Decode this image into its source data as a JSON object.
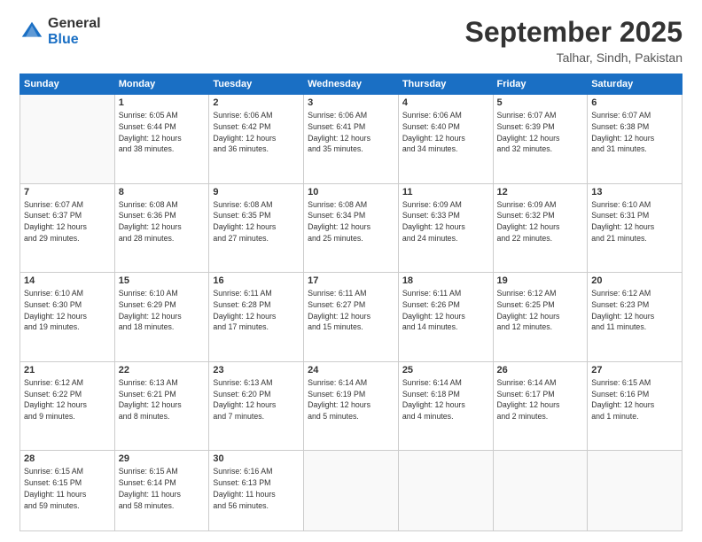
{
  "logo": {
    "general": "General",
    "blue": "Blue"
  },
  "title": {
    "month_year": "September 2025",
    "location": "Talhar, Sindh, Pakistan"
  },
  "days_header": [
    "Sunday",
    "Monday",
    "Tuesday",
    "Wednesday",
    "Thursday",
    "Friday",
    "Saturday"
  ],
  "weeks": [
    [
      {
        "num": "",
        "info": ""
      },
      {
        "num": "1",
        "info": "Sunrise: 6:05 AM\nSunset: 6:44 PM\nDaylight: 12 hours\nand 38 minutes."
      },
      {
        "num": "2",
        "info": "Sunrise: 6:06 AM\nSunset: 6:42 PM\nDaylight: 12 hours\nand 36 minutes."
      },
      {
        "num": "3",
        "info": "Sunrise: 6:06 AM\nSunset: 6:41 PM\nDaylight: 12 hours\nand 35 minutes."
      },
      {
        "num": "4",
        "info": "Sunrise: 6:06 AM\nSunset: 6:40 PM\nDaylight: 12 hours\nand 34 minutes."
      },
      {
        "num": "5",
        "info": "Sunrise: 6:07 AM\nSunset: 6:39 PM\nDaylight: 12 hours\nand 32 minutes."
      },
      {
        "num": "6",
        "info": "Sunrise: 6:07 AM\nSunset: 6:38 PM\nDaylight: 12 hours\nand 31 minutes."
      }
    ],
    [
      {
        "num": "7",
        "info": "Sunrise: 6:07 AM\nSunset: 6:37 PM\nDaylight: 12 hours\nand 29 minutes."
      },
      {
        "num": "8",
        "info": "Sunrise: 6:08 AM\nSunset: 6:36 PM\nDaylight: 12 hours\nand 28 minutes."
      },
      {
        "num": "9",
        "info": "Sunrise: 6:08 AM\nSunset: 6:35 PM\nDaylight: 12 hours\nand 27 minutes."
      },
      {
        "num": "10",
        "info": "Sunrise: 6:08 AM\nSunset: 6:34 PM\nDaylight: 12 hours\nand 25 minutes."
      },
      {
        "num": "11",
        "info": "Sunrise: 6:09 AM\nSunset: 6:33 PM\nDaylight: 12 hours\nand 24 minutes."
      },
      {
        "num": "12",
        "info": "Sunrise: 6:09 AM\nSunset: 6:32 PM\nDaylight: 12 hours\nand 22 minutes."
      },
      {
        "num": "13",
        "info": "Sunrise: 6:10 AM\nSunset: 6:31 PM\nDaylight: 12 hours\nand 21 minutes."
      }
    ],
    [
      {
        "num": "14",
        "info": "Sunrise: 6:10 AM\nSunset: 6:30 PM\nDaylight: 12 hours\nand 19 minutes."
      },
      {
        "num": "15",
        "info": "Sunrise: 6:10 AM\nSunset: 6:29 PM\nDaylight: 12 hours\nand 18 minutes."
      },
      {
        "num": "16",
        "info": "Sunrise: 6:11 AM\nSunset: 6:28 PM\nDaylight: 12 hours\nand 17 minutes."
      },
      {
        "num": "17",
        "info": "Sunrise: 6:11 AM\nSunset: 6:27 PM\nDaylight: 12 hours\nand 15 minutes."
      },
      {
        "num": "18",
        "info": "Sunrise: 6:11 AM\nSunset: 6:26 PM\nDaylight: 12 hours\nand 14 minutes."
      },
      {
        "num": "19",
        "info": "Sunrise: 6:12 AM\nSunset: 6:25 PM\nDaylight: 12 hours\nand 12 minutes."
      },
      {
        "num": "20",
        "info": "Sunrise: 6:12 AM\nSunset: 6:23 PM\nDaylight: 12 hours\nand 11 minutes."
      }
    ],
    [
      {
        "num": "21",
        "info": "Sunrise: 6:12 AM\nSunset: 6:22 PM\nDaylight: 12 hours\nand 9 minutes."
      },
      {
        "num": "22",
        "info": "Sunrise: 6:13 AM\nSunset: 6:21 PM\nDaylight: 12 hours\nand 8 minutes."
      },
      {
        "num": "23",
        "info": "Sunrise: 6:13 AM\nSunset: 6:20 PM\nDaylight: 12 hours\nand 7 minutes."
      },
      {
        "num": "24",
        "info": "Sunrise: 6:14 AM\nSunset: 6:19 PM\nDaylight: 12 hours\nand 5 minutes."
      },
      {
        "num": "25",
        "info": "Sunrise: 6:14 AM\nSunset: 6:18 PM\nDaylight: 12 hours\nand 4 minutes."
      },
      {
        "num": "26",
        "info": "Sunrise: 6:14 AM\nSunset: 6:17 PM\nDaylight: 12 hours\nand 2 minutes."
      },
      {
        "num": "27",
        "info": "Sunrise: 6:15 AM\nSunset: 6:16 PM\nDaylight: 12 hours\nand 1 minute."
      }
    ],
    [
      {
        "num": "28",
        "info": "Sunrise: 6:15 AM\nSunset: 6:15 PM\nDaylight: 11 hours\nand 59 minutes."
      },
      {
        "num": "29",
        "info": "Sunrise: 6:15 AM\nSunset: 6:14 PM\nDaylight: 11 hours\nand 58 minutes."
      },
      {
        "num": "30",
        "info": "Sunrise: 6:16 AM\nSunset: 6:13 PM\nDaylight: 11 hours\nand 56 minutes."
      },
      {
        "num": "",
        "info": ""
      },
      {
        "num": "",
        "info": ""
      },
      {
        "num": "",
        "info": ""
      },
      {
        "num": "",
        "info": ""
      }
    ]
  ]
}
